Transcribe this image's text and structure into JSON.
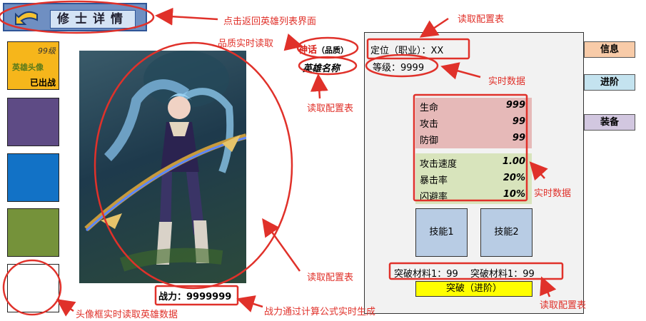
{
  "header": {
    "title": "修士详情"
  },
  "slots": {
    "level": "99级",
    "avatar_label": "英雄头像",
    "deployed": "已出战"
  },
  "hero": {
    "quality": "神话",
    "quality_tag": "（品质）",
    "name": "英雄名称",
    "power": "战力：9999999"
  },
  "panel": {
    "role": "定位（职业）：XX",
    "level": "等级：9999",
    "stats_a": [
      {
        "label": "生命",
        "value": "999"
      },
      {
        "label": "攻击",
        "value": "99"
      },
      {
        "label": "防御",
        "value": "99"
      }
    ],
    "stats_b": [
      {
        "label": "攻击速度",
        "value": "1.00"
      },
      {
        "label": "暴击率",
        "value": "20%"
      },
      {
        "label": "闪避率",
        "value": "10%"
      }
    ],
    "skills": [
      "技能1",
      "技能2"
    ],
    "materials": "突破材料1：99　 突破材料1：99",
    "breakthrough_button": "突破（进阶）"
  },
  "tabs": [
    "信息",
    "进阶",
    "装备"
  ],
  "annotations": {
    "back": "点击返回英雄列表界面",
    "quality_live": "品质实时读取",
    "config_top": "读取配置表",
    "config_name": "读取配置表",
    "realtime_level": "实时数据",
    "realtime_stats": "实时数据",
    "config_art": "读取配置表",
    "config_mats": "读取配置表",
    "avatar_frame": "头像框实时读取英雄数据",
    "power_formula": "战力通过计算公式实时生成"
  },
  "colors": {
    "annotation": "#e0312a",
    "accent_header": "#6f8fc2",
    "breakthrough": "#ffff00"
  }
}
